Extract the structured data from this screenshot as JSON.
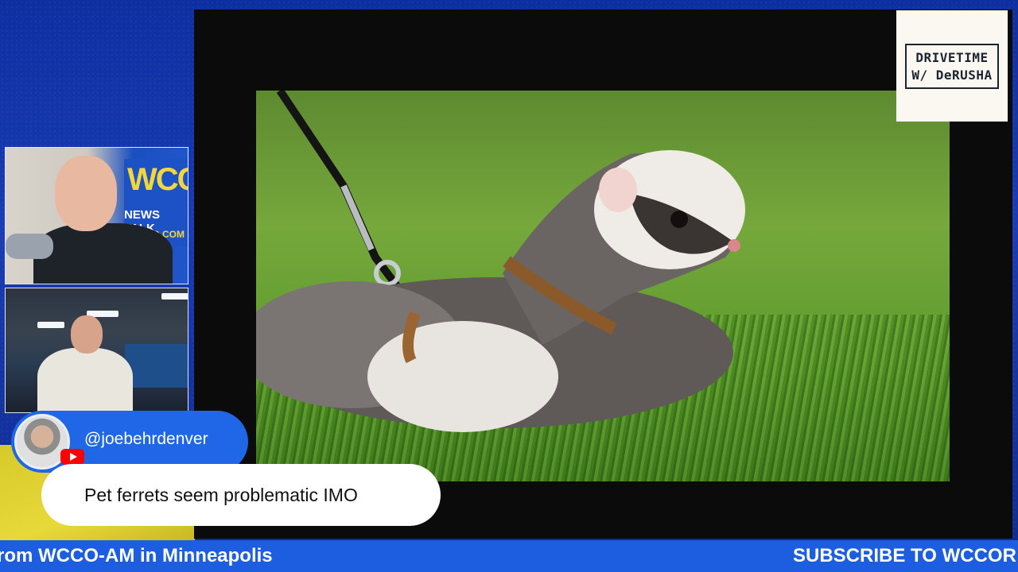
{
  "logo": {
    "line1": "DRIVETIME",
    "line2": "W/ DeRUSHA"
  },
  "camera_one": {
    "sign_brand": "WCCO",
    "sign_sub": "NEWS TALK",
    "sign_url": "RADIO.COM"
  },
  "chat": {
    "handle": "@joebehrdenver",
    "platform": "youtube-icon",
    "message": "Pet ferrets seem problematic IMO"
  },
  "ticker": {
    "left_text": "rom WCCO-AM in Minneapolis",
    "right_text": "SUBSCRIBE TO WCCOR"
  },
  "colors": {
    "accent_blue": "#1f67e6",
    "ticker_blue": "#1d5ee0",
    "youtube_red": "#ff0000",
    "background_blue": "#1a3cb5",
    "background_yellow": "#e8d93a"
  }
}
